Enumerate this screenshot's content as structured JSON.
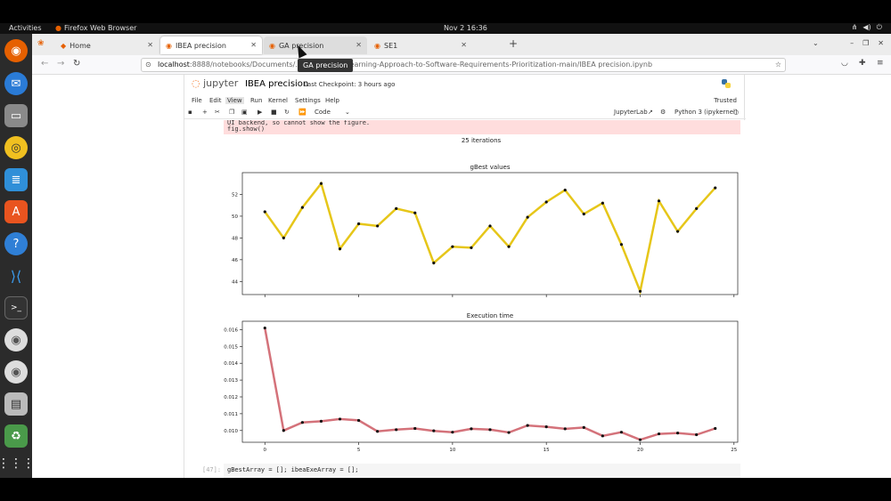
{
  "os": {
    "activities": "Activities",
    "app_name": "Firefox Web Browser",
    "clock": "Nov 2  16:36"
  },
  "browser": {
    "tabs": [
      {
        "label": "Home"
      },
      {
        "label": "IBEA precision"
      },
      {
        "label": "GA precision"
      },
      {
        "label": "SE1"
      }
    ],
    "tooltip": "GA precision",
    "url_host": "localhost",
    "url_rest": ":8888/notebooks/Documents/…/le/Machine-Learning-Approach-to-Software-Requirements-Prioritization-main/IBEA precision.ipynb"
  },
  "jupyter": {
    "logo_text": "jupyter",
    "title": "IBEA precision",
    "checkpoint": "Last Checkpoint: 3 hours ago",
    "menu": [
      "File",
      "Edit",
      "View",
      "Run",
      "Kernel",
      "Settings",
      "Help"
    ],
    "trusted": "Trusted",
    "cell_type": "Code",
    "jupyterlab": "JupyterLab",
    "kernel": "Python 3 (ipykernel)",
    "error_line1": "UI backend, so cannot show the figure.",
    "error_line2": "  fig.show()",
    "next_prompt": "[47]:",
    "next_code": "gBestArray = []; ibeaExeArray = [];"
  },
  "chart_data": {
    "type": "line",
    "suptitle": "25 iterations",
    "subplots": [
      {
        "title": "gBest values",
        "x": [
          0,
          1,
          2,
          3,
          4,
          5,
          6,
          7,
          8,
          9,
          10,
          11,
          12,
          13,
          14,
          15,
          16,
          17,
          18,
          19,
          20,
          21,
          22,
          23,
          24
        ],
        "y": [
          50.4,
          48.0,
          50.8,
          53.0,
          47.0,
          49.3,
          49.1,
          50.7,
          50.3,
          45.7,
          47.2,
          47.1,
          49.1,
          47.2,
          49.9,
          51.3,
          52.4,
          50.2,
          51.2,
          47.4,
          43.1,
          51.4,
          48.6,
          50.7,
          52.6
        ],
        "ylim": [
          42.8,
          54.0
        ],
        "yticks": [
          44,
          46,
          48,
          50,
          52
        ],
        "line_color": "#e6c619",
        "marker_color": "#111111"
      },
      {
        "title": "Execution time",
        "x": [
          0,
          1,
          2,
          3,
          4,
          5,
          6,
          7,
          8,
          9,
          10,
          11,
          12,
          13,
          14,
          15,
          16,
          17,
          18,
          19,
          20,
          21,
          22,
          23,
          24
        ],
        "y": [
          0.0161,
          0.01,
          0.01048,
          0.01055,
          0.01068,
          0.0106,
          0.00995,
          0.01005,
          0.01012,
          0.00998,
          0.0099,
          0.0101,
          0.01005,
          0.00988,
          0.0103,
          0.01022,
          0.0101,
          0.01018,
          0.00968,
          0.0099,
          0.00945,
          0.0098,
          0.00985,
          0.00975,
          0.01012
        ],
        "ylim": [
          0.0093,
          0.0165
        ],
        "yticks": [
          0.01,
          0.011,
          0.012,
          0.013,
          0.014,
          0.015,
          0.016
        ],
        "xlim": [
          -1.2,
          25.2
        ],
        "xticks": [
          0,
          5,
          10,
          15,
          20,
          25
        ],
        "line_color": "#d4727a",
        "marker_color": "#111111"
      }
    ],
    "grid": false
  }
}
